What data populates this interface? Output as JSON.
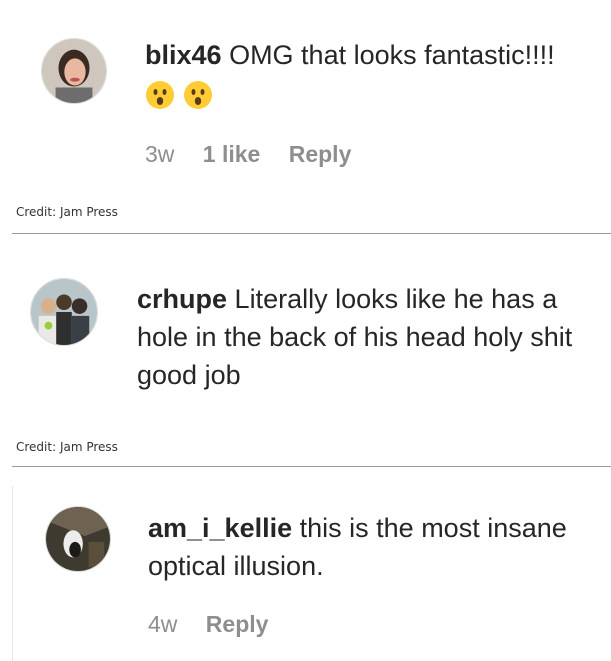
{
  "comments": [
    {
      "username": "blix46",
      "text": "OMG that looks fantastic!!!!",
      "emoji_icons": [
        "astonished-face-icon",
        "astonished-face-icon"
      ],
      "meta": {
        "time": "3w",
        "likes": "1 like",
        "reply": "Reply"
      }
    },
    {
      "username": "crhupe",
      "text": "Literally looks like he has a hole in the back of his head holy shit good job"
    },
    {
      "username": "am_i_kellie",
      "text": "this is the most insane optical illusion.",
      "meta": {
        "time": "4w",
        "reply": "Reply"
      }
    }
  ],
  "credits": [
    "Credit: Jam Press",
    "Credit: Jam Press"
  ],
  "colors": {
    "text": "#262626",
    "meta": "#8e8e8e",
    "divider": "#9a9a9a"
  }
}
